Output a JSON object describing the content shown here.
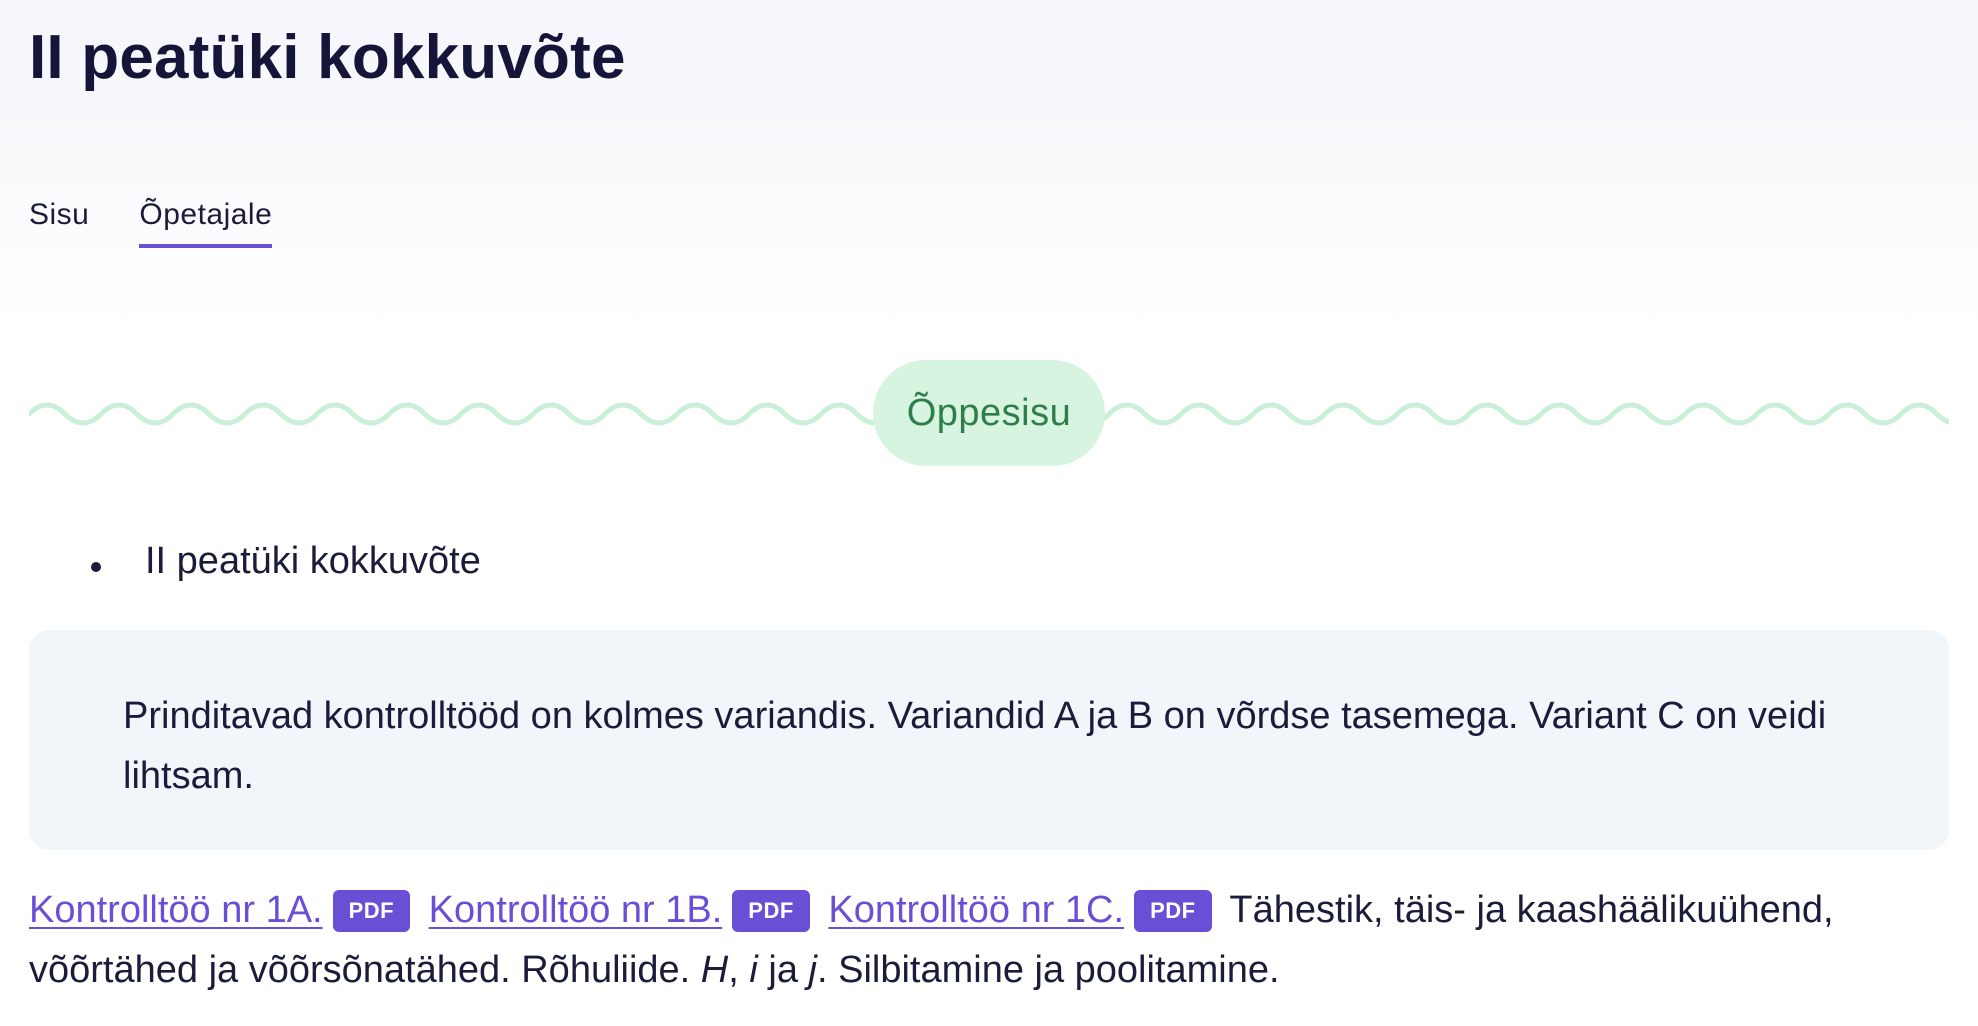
{
  "page": {
    "title": "II peatüki kokkuvõte"
  },
  "tabs": [
    {
      "label": "Sisu",
      "active": false
    },
    {
      "label": "Õpetajale",
      "active": true
    }
  ],
  "section": {
    "label": "Õppesisu"
  },
  "bullets": [
    {
      "text": "II peatüki kokkuvõte"
    }
  ],
  "note": {
    "text": "Prinditavad kontrolltööd on kolmes variandis. Variandid A ja B on võrdse tasemega. Variant C on veidi lihtsam."
  },
  "links": [
    {
      "label": "Kontrolltöö nr 1A.",
      "badge": "PDF"
    },
    {
      "label": "Kontrolltöö nr 1B.",
      "badge": "PDF"
    },
    {
      "label": "Kontrolltöö nr 1C.",
      "badge": "PDF"
    }
  ],
  "summary": {
    "text_part1": " Tähestik, täis- ja kaashäälikuühend, võõrtähed ja võõrsõnatähed. Rõhuliide. ",
    "italic_h": "H",
    "text_comma": ", ",
    "italic_i": "i",
    "text_and": " ja ",
    "italic_j": "j",
    "text_part2": ". Silbitamine ja poolitamine."
  },
  "colors": {
    "accent": "#6a4fd6",
    "pill_background": "#d6f4e0",
    "pill_text": "#2f7d4a",
    "wave": "#c9efd8",
    "note_background": "#f1f6fa"
  }
}
